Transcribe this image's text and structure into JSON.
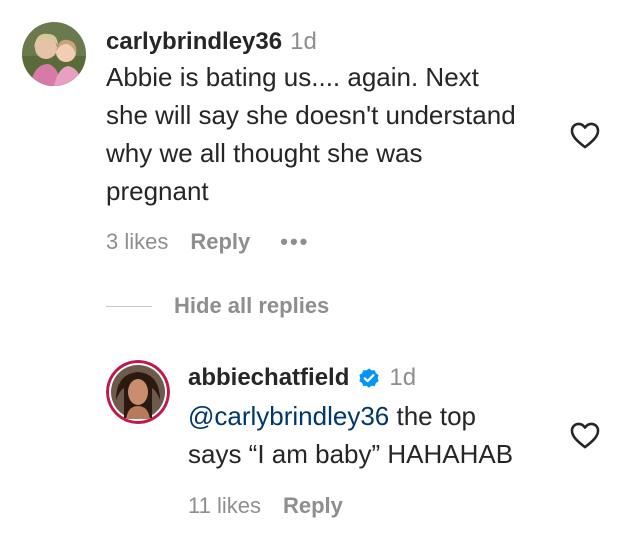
{
  "comment": {
    "username": "carlybrindley36",
    "time": "1d",
    "lines": [
      "Abbie is bating us.... again. Next",
      "she will say she doesn't understand",
      "why we all thought she was",
      "pregnant"
    ],
    "likes": "3 likes",
    "reply_label": "Reply",
    "more_label": "•••"
  },
  "replies_toggle": {
    "label": "Hide all replies"
  },
  "reply": {
    "username": "abbiechatfield",
    "time": "1d",
    "mention": "@carlybrindley36",
    "line1_rest": " the top",
    "line2": "says “I am baby” HAHAHAB",
    "likes": "11 likes",
    "reply_label": "Reply"
  },
  "colors": {
    "text": "#262626",
    "muted": "#8e8e8e",
    "mention": "#00376b",
    "verified": "#0095f6"
  },
  "icons": {
    "like": "heart-outline-icon",
    "verified": "verified-badge-icon",
    "more": "more-options-icon"
  }
}
